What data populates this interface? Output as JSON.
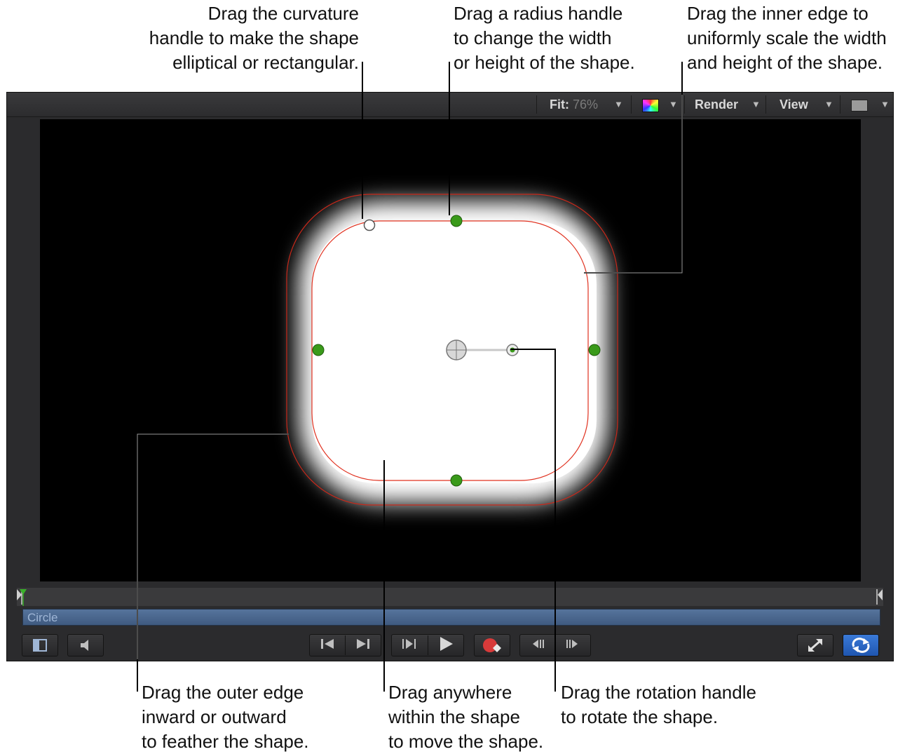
{
  "callouts": {
    "curvature": "Drag the curvature\nhandle to make the shape\nelliptical or rectangular.",
    "radius": "Drag a radius handle\nto change the width\nor height of the shape.",
    "inner_edge": "Drag the inner edge to\nuniformly scale the width\nand height of the shape.",
    "outer_edge": "Drag the outer edge\ninward or outward\nto feather the shape.",
    "anywhere": "Drag anywhere\nwithin the shape\nto move the shape.",
    "rotation": "Drag the rotation handle\nto rotate the shape."
  },
  "toolbar": {
    "fit_label": "Fit:",
    "fit_value": "76%",
    "render_label": "Render",
    "view_label": "View"
  },
  "timeline": {
    "track_label": "Circle"
  },
  "colors": {
    "canvas": "#000000",
    "shape_outline": "#e0301e",
    "handle_green": "#3a9a1a",
    "track_blue": "#4a6890",
    "loop_button_blue": "#2a66c4"
  },
  "icons": {
    "fit_dropdown": "triangle-down-icon",
    "color_channels": "color-swatch-icon",
    "play": "play-icon",
    "record": "record-icon",
    "fullscreen": "expand-arrows-icon",
    "loop": "loop-icon"
  }
}
